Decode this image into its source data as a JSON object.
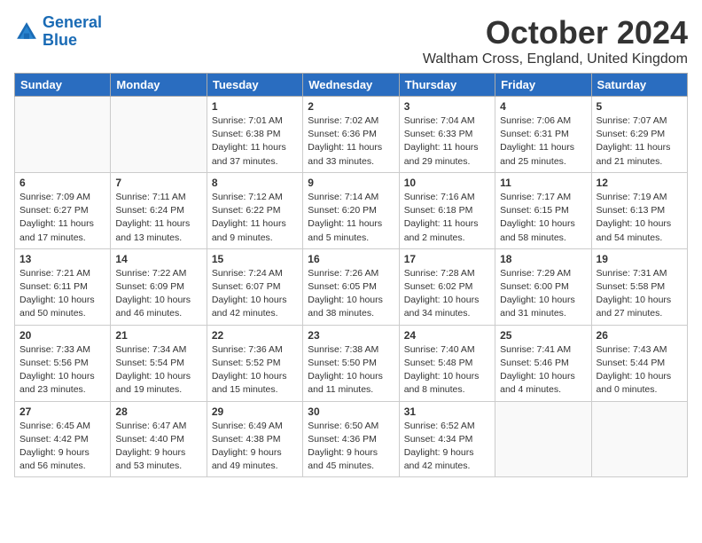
{
  "header": {
    "logo_line1": "General",
    "logo_line2": "Blue",
    "month": "October 2024",
    "location": "Waltham Cross, England, United Kingdom"
  },
  "days_of_week": [
    "Sunday",
    "Monday",
    "Tuesday",
    "Wednesday",
    "Thursday",
    "Friday",
    "Saturday"
  ],
  "weeks": [
    [
      {
        "day": "",
        "info": ""
      },
      {
        "day": "",
        "info": ""
      },
      {
        "day": "1",
        "info": "Sunrise: 7:01 AM\nSunset: 6:38 PM\nDaylight: 11 hours and 37 minutes."
      },
      {
        "day": "2",
        "info": "Sunrise: 7:02 AM\nSunset: 6:36 PM\nDaylight: 11 hours and 33 minutes."
      },
      {
        "day": "3",
        "info": "Sunrise: 7:04 AM\nSunset: 6:33 PM\nDaylight: 11 hours and 29 minutes."
      },
      {
        "day": "4",
        "info": "Sunrise: 7:06 AM\nSunset: 6:31 PM\nDaylight: 11 hours and 25 minutes."
      },
      {
        "day": "5",
        "info": "Sunrise: 7:07 AM\nSunset: 6:29 PM\nDaylight: 11 hours and 21 minutes."
      }
    ],
    [
      {
        "day": "6",
        "info": "Sunrise: 7:09 AM\nSunset: 6:27 PM\nDaylight: 11 hours and 17 minutes."
      },
      {
        "day": "7",
        "info": "Sunrise: 7:11 AM\nSunset: 6:24 PM\nDaylight: 11 hours and 13 minutes."
      },
      {
        "day": "8",
        "info": "Sunrise: 7:12 AM\nSunset: 6:22 PM\nDaylight: 11 hours and 9 minutes."
      },
      {
        "day": "9",
        "info": "Sunrise: 7:14 AM\nSunset: 6:20 PM\nDaylight: 11 hours and 5 minutes."
      },
      {
        "day": "10",
        "info": "Sunrise: 7:16 AM\nSunset: 6:18 PM\nDaylight: 11 hours and 2 minutes."
      },
      {
        "day": "11",
        "info": "Sunrise: 7:17 AM\nSunset: 6:15 PM\nDaylight: 10 hours and 58 minutes."
      },
      {
        "day": "12",
        "info": "Sunrise: 7:19 AM\nSunset: 6:13 PM\nDaylight: 10 hours and 54 minutes."
      }
    ],
    [
      {
        "day": "13",
        "info": "Sunrise: 7:21 AM\nSunset: 6:11 PM\nDaylight: 10 hours and 50 minutes."
      },
      {
        "day": "14",
        "info": "Sunrise: 7:22 AM\nSunset: 6:09 PM\nDaylight: 10 hours and 46 minutes."
      },
      {
        "day": "15",
        "info": "Sunrise: 7:24 AM\nSunset: 6:07 PM\nDaylight: 10 hours and 42 minutes."
      },
      {
        "day": "16",
        "info": "Sunrise: 7:26 AM\nSunset: 6:05 PM\nDaylight: 10 hours and 38 minutes."
      },
      {
        "day": "17",
        "info": "Sunrise: 7:28 AM\nSunset: 6:02 PM\nDaylight: 10 hours and 34 minutes."
      },
      {
        "day": "18",
        "info": "Sunrise: 7:29 AM\nSunset: 6:00 PM\nDaylight: 10 hours and 31 minutes."
      },
      {
        "day": "19",
        "info": "Sunrise: 7:31 AM\nSunset: 5:58 PM\nDaylight: 10 hours and 27 minutes."
      }
    ],
    [
      {
        "day": "20",
        "info": "Sunrise: 7:33 AM\nSunset: 5:56 PM\nDaylight: 10 hours and 23 minutes."
      },
      {
        "day": "21",
        "info": "Sunrise: 7:34 AM\nSunset: 5:54 PM\nDaylight: 10 hours and 19 minutes."
      },
      {
        "day": "22",
        "info": "Sunrise: 7:36 AM\nSunset: 5:52 PM\nDaylight: 10 hours and 15 minutes."
      },
      {
        "day": "23",
        "info": "Sunrise: 7:38 AM\nSunset: 5:50 PM\nDaylight: 10 hours and 11 minutes."
      },
      {
        "day": "24",
        "info": "Sunrise: 7:40 AM\nSunset: 5:48 PM\nDaylight: 10 hours and 8 minutes."
      },
      {
        "day": "25",
        "info": "Sunrise: 7:41 AM\nSunset: 5:46 PM\nDaylight: 10 hours and 4 minutes."
      },
      {
        "day": "26",
        "info": "Sunrise: 7:43 AM\nSunset: 5:44 PM\nDaylight: 10 hours and 0 minutes."
      }
    ],
    [
      {
        "day": "27",
        "info": "Sunrise: 6:45 AM\nSunset: 4:42 PM\nDaylight: 9 hours and 56 minutes."
      },
      {
        "day": "28",
        "info": "Sunrise: 6:47 AM\nSunset: 4:40 PM\nDaylight: 9 hours and 53 minutes."
      },
      {
        "day": "29",
        "info": "Sunrise: 6:49 AM\nSunset: 4:38 PM\nDaylight: 9 hours and 49 minutes."
      },
      {
        "day": "30",
        "info": "Sunrise: 6:50 AM\nSunset: 4:36 PM\nDaylight: 9 hours and 45 minutes."
      },
      {
        "day": "31",
        "info": "Sunrise: 6:52 AM\nSunset: 4:34 PM\nDaylight: 9 hours and 42 minutes."
      },
      {
        "day": "",
        "info": ""
      },
      {
        "day": "",
        "info": ""
      }
    ]
  ]
}
